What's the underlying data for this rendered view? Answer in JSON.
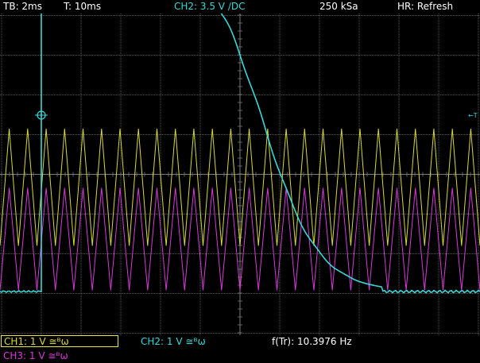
{
  "colors": {
    "background": "#000000",
    "text": "#ffffff",
    "grid": "#7a7a7a",
    "ch1": "#d8d83a",
    "ch2": "#39d8d8",
    "ch3": "#d83ad8",
    "ch1_box": "#e6e640"
  },
  "status": {
    "timebase": "TB: 2ms",
    "trigger_time": "T: 10ms",
    "trigger": "CH2: 3.5 V ∕DC",
    "sample_rate": "250 kSa",
    "hr_mode": "HR: Refresh"
  },
  "channels": {
    "ch1": "CH1: 1 V ≅ᴮω",
    "ch2": "CH2: 1 V ≅ᴮω",
    "ch3": "CH3: 1 V ≅ᴮω"
  },
  "measurement": "f(Tr): 10.3976 Hz",
  "markers": {
    "trigger_level": "←T"
  },
  "waveforms": {
    "ch1_triangle": {
      "cycles": 26,
      "low": -1.8,
      "high": 1.15
    },
    "ch3_triangle": {
      "cycles": 26,
      "low": -2.92,
      "high": -0.34
    },
    "ch2_step": {
      "start_time": -5.0,
      "high_level": 5.7,
      "low_level": -2.95,
      "knee_time": 4.2,
      "end_time": 15.0
    }
  }
}
